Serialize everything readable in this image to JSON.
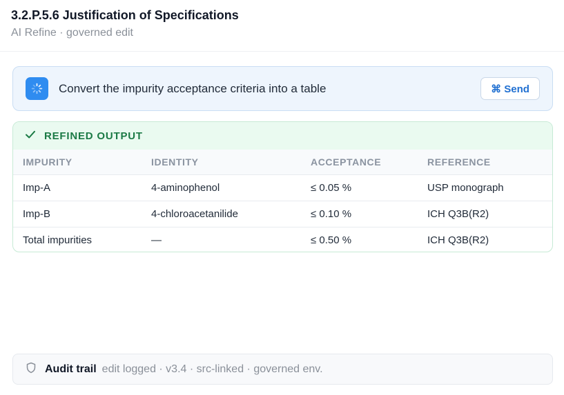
{
  "header": {
    "title": "3.2.P.5.6 Justification of Specifications",
    "subtitle": "AI Refine · governed edit"
  },
  "prompt": {
    "icon": "spinner-icon",
    "text": "Convert the impurity acceptance criteria into a table",
    "send_label": "⌘ Send",
    "accent_color": "#2f8cf0"
  },
  "output": {
    "status_icon": "check-icon",
    "label": "REFINED OUTPUT",
    "status_color": "#1b7a45",
    "columns": [
      "IMPURITY",
      "IDENTITY",
      "ACCEPTANCE",
      "REFERENCE"
    ],
    "rows": [
      [
        "Imp-A",
        "4-aminophenol",
        "≤ 0.05 %",
        "USP monograph"
      ],
      [
        "Imp-B",
        "4-chloroacetanilide",
        "≤ 0.10 %",
        "ICH Q3B(R2)"
      ],
      [
        "Total impurities",
        "—",
        "≤ 0.50 %",
        "ICH Q3B(R2)"
      ]
    ]
  },
  "audit": {
    "icon": "shield-icon",
    "title": "Audit trail",
    "meta": "edit logged · v3.4 · src-linked · governed env."
  }
}
